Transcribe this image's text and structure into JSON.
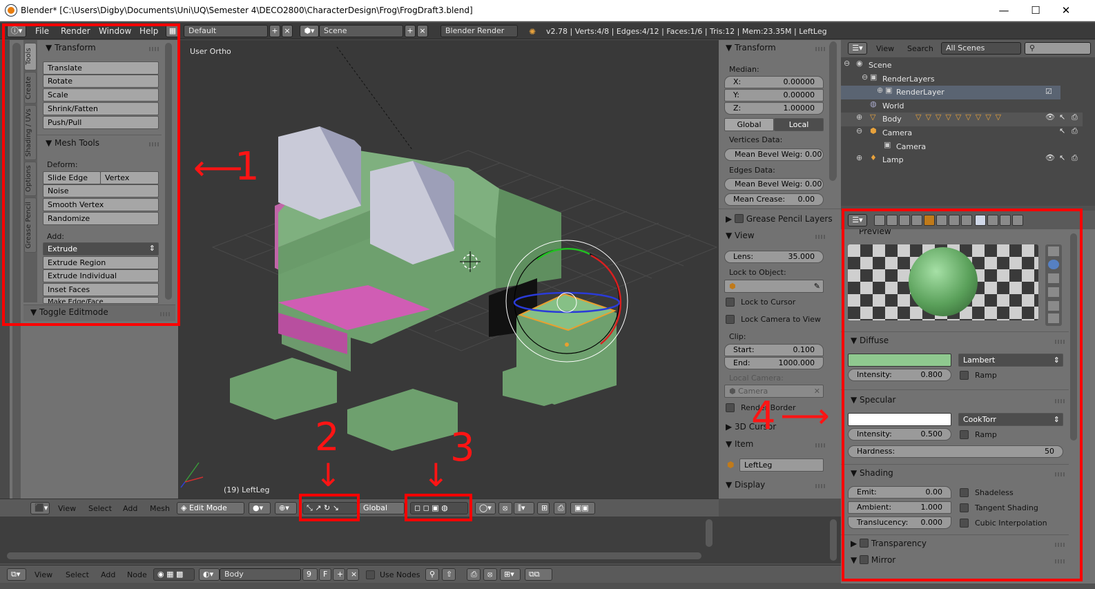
{
  "window": {
    "title": "Blender* [C:\\Users\\Digby\\Documents\\Uni\\UQ\\Semester 4\\DECO2800\\CharacterDesign\\Frog\\FrogDraft3.blend]",
    "minimize": "—",
    "maximize": "☐",
    "close": "✕"
  },
  "infobar": {
    "menus": [
      "File",
      "Render",
      "Window",
      "Help"
    ],
    "layout": "Default",
    "scene": "Scene",
    "engine": "Blender Render",
    "stats": "v2.78 | Verts:4/8 | Edges:4/12 | Faces:1/6 | Tris:12 | Mem:23.35M | LeftLeg"
  },
  "tool_shelf": {
    "tabs": [
      "Tools",
      "Create",
      "Shading / UVs",
      "Options",
      "Grease Pencil"
    ],
    "transform_title": "Transform",
    "transform_buttons": [
      "Translate",
      "Rotate",
      "Scale",
      "Shrink/Fatten",
      "Push/Pull"
    ],
    "mesh_tools_title": "Mesh Tools",
    "deform_label": "Deform:",
    "slide_edge": "Slide Edge",
    "vertex": "Vertex",
    "deform_buttons": [
      "Noise",
      "Smooth Vertex",
      "Randomize"
    ],
    "add_label": "Add:",
    "extrude": "Extrude",
    "add_buttons": [
      "Extrude Region",
      "Extrude Individual",
      "Inset Faces",
      "Make Edge/Face"
    ],
    "toggle_editmode": "Toggle Editmode"
  },
  "viewport": {
    "view_label": "User Ortho",
    "object_label": "(19) LeftLeg"
  },
  "viewport_header": {
    "menus": [
      "View",
      "Select",
      "Add",
      "Mesh"
    ],
    "mode": "Edit Mode",
    "orientation": "Global"
  },
  "bottom_header": {
    "menus": [
      "View",
      "Select",
      "Add",
      "Node"
    ],
    "material": "Body",
    "users": "9",
    "fake": "F",
    "use_nodes": "Use Nodes"
  },
  "n_panel": {
    "transform_title": "Transform",
    "median_label": "Median:",
    "x_label": "X:",
    "x_value": "0.00000",
    "y_label": "Y:",
    "y_value": "0.00000",
    "z_label": "Z:",
    "z_value": "1.00000",
    "global": "Global",
    "local": "Local",
    "vertices_data": "Vertices Data:",
    "mean_bevel_vert": "Mean Bevel Weig: 0.00",
    "edges_data": "Edges Data:",
    "mean_bevel_edge": "Mean Bevel Weig: 0.00",
    "mean_crease_label": "Mean Crease:",
    "mean_crease_value": "0.00",
    "grease_pencil_layers": "Grease Pencil Layers",
    "view_title": "View",
    "lens_label": "Lens:",
    "lens_value": "35.000",
    "lock_to_object": "Lock to Object:",
    "lock_to_cursor": "Lock to Cursor",
    "lock_camera": "Lock Camera to View",
    "clip_label": "Clip:",
    "start_label": "Start:",
    "start_value": "0.100",
    "end_label": "End:",
    "end_value": "1000.000",
    "local_camera": "Local Camera:",
    "camera": "Camera",
    "render_border": "Render Border",
    "cursor_title": "3D Cursor",
    "item_title": "Item",
    "item_name": "LeftLeg",
    "display_title": "Display"
  },
  "outliner": {
    "menus": [
      "View",
      "Search"
    ],
    "filter": "All Scenes",
    "rows": [
      "Scene",
      "RenderLayers",
      "RenderLayer",
      "World",
      "Body",
      "Camera",
      "Camera",
      "Lamp"
    ]
  },
  "properties": {
    "preview_title": "Preview",
    "diffuse_title": "Diffuse",
    "diffuse_shader": "Lambert",
    "diffuse_intensity_label": "Intensity:",
    "diffuse_intensity": "0.800",
    "ramp": "Ramp",
    "specular_title": "Specular",
    "specular_shader": "CookTorr",
    "specular_intensity_label": "Intensity:",
    "specular_intensity": "0.500",
    "hardness_label": "Hardness:",
    "hardness": "50",
    "shading_title": "Shading",
    "emit_label": "Emit:",
    "emit": "0.00",
    "ambient_label": "Ambient:",
    "ambient": "1.000",
    "translucency_label": "Translucency:",
    "translucency": "0.000",
    "shadeless": "Shadeless",
    "tangent_shading": "Tangent Shading",
    "cubic_interpolation": "Cubic Interpolation",
    "transparency_title": "Transparency",
    "mirror_title": "Mirror"
  },
  "colors": {
    "diffuse": "#8fc98f",
    "specular": "#ffffff",
    "annotation": "#ff0000"
  },
  "annotations": [
    "1",
    "2",
    "3",
    "4"
  ]
}
